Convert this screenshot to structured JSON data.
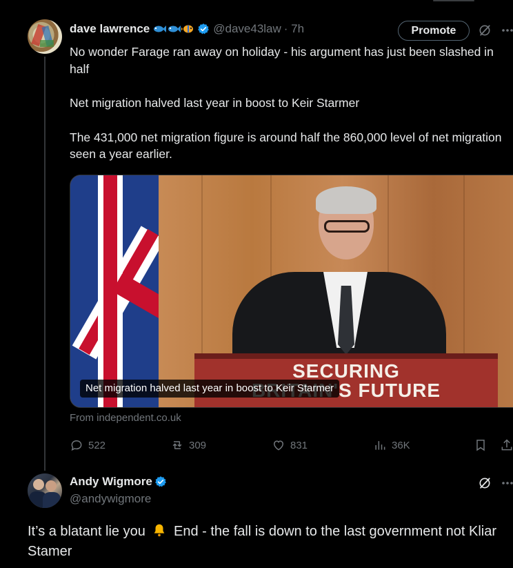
{
  "tweet": {
    "author_name": "dave lawrence",
    "handle": "@dave43law",
    "time": "· 7h",
    "promote_label": "Promote",
    "paragraphs": [
      "No wonder Farage ran away on holiday - his argument has just been slashed in half",
      "Net migration halved last year in boost to Keir Starmer",
      "The 431,000 net migration figure is around half the 860,000 level of net migration seen a year earlier."
    ],
    "media": {
      "caption": "Net migration halved last year in boost to Keir Starmer",
      "podium_text_line1": "SECURING",
      "podium_text_line2": "BRITAIN'S FUTURE"
    },
    "source": "From independent.co.uk",
    "stats": {
      "replies": "522",
      "reposts": "309",
      "likes": "831",
      "views": "36K"
    }
  },
  "reply": {
    "author_name": "Andy Wigmore",
    "handle": "@andywigmore",
    "text_before": "It’s a blatant lie you",
    "text_after": "End - the fall is down to the last government not Kliar Stamer"
  },
  "colors": {
    "background": "#000000",
    "text": "#e7e9ea",
    "muted": "#71767b",
    "verified": "#1d9bf0",
    "border": "#2f3336"
  },
  "icons": [
    "fish-icon",
    "verified-icon",
    "grok-icon",
    "more-icon",
    "reply-icon",
    "repost-icon",
    "like-icon",
    "views-icon",
    "bookmark-icon",
    "share-icon",
    "bell-icon"
  ]
}
